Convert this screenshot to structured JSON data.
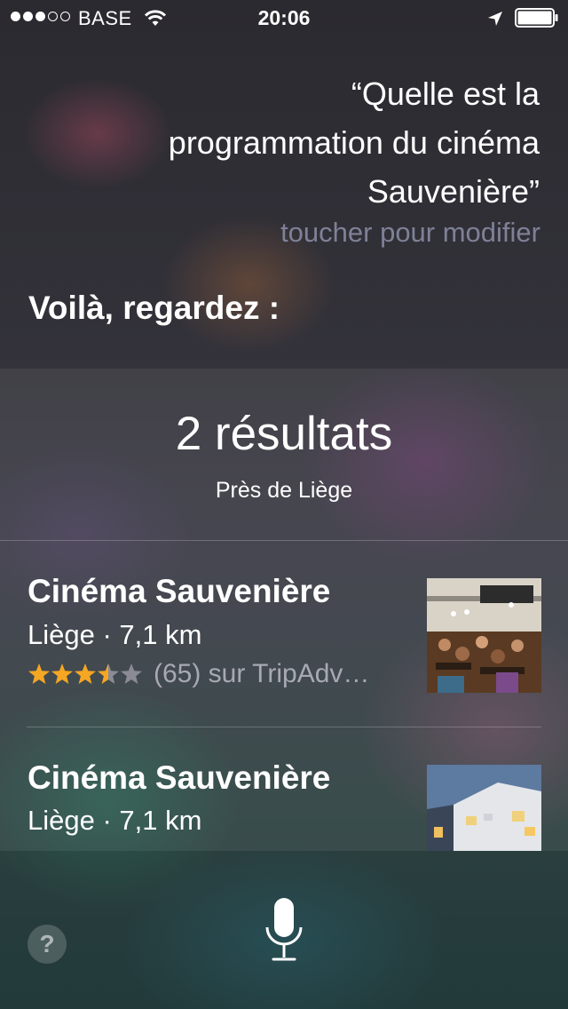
{
  "status_bar": {
    "signal_full": 3,
    "signal_empty": 2,
    "carrier": "BASE",
    "time": "20:06",
    "icons": [
      "wifi-icon",
      "location-arrow-icon",
      "battery-icon"
    ]
  },
  "siri": {
    "query": "“Quelle est la programmation du cinéma Sauvenière”",
    "tap_to_edit": "toucher pour modifier",
    "response": "Voilà, regardez :"
  },
  "results": {
    "count_label": "2 résultats",
    "location_label": "Près de Liège",
    "items": [
      {
        "name": "Cinéma Sauvenière",
        "meta": "Liège · 7,1 km",
        "rating": 3.5,
        "rating_max": 5,
        "rating_text": "(65) sur TripAdv…",
        "thumbnail": "cinema-interior-photo"
      },
      {
        "name": "Cinéma Sauvenière",
        "meta": "Liège · 7,1 km",
        "thumbnail": "cinema-building-photo"
      }
    ]
  },
  "bottom": {
    "help_label": "?",
    "mic_icon": "microphone-icon"
  },
  "colors": {
    "star_filled": "#f5a623",
    "star_empty": "#8a8b94",
    "secondary_text": "#7e8197"
  }
}
